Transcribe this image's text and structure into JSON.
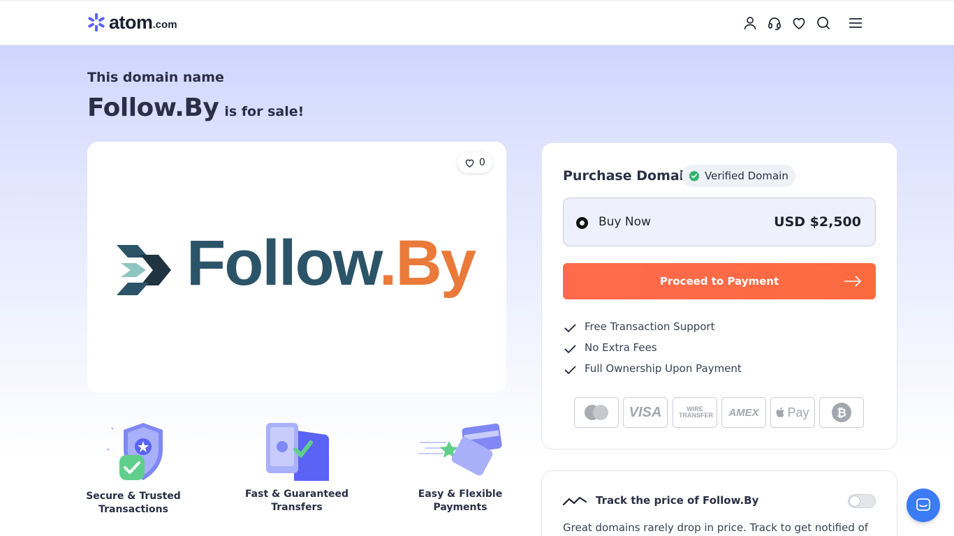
{
  "header": {
    "logo_word": "atom",
    "logo_tld": ".com",
    "icons": [
      "user-icon",
      "headset-icon",
      "heart-icon",
      "search-icon",
      "menu-icon"
    ]
  },
  "hero": {
    "eyebrow": "This domain name",
    "domain": "Follow.By",
    "suffix": "is for sale!"
  },
  "preview": {
    "like_count": "0",
    "brand_name": "Follow",
    "brand_tld": ".By"
  },
  "features": [
    {
      "label": "Secure & Trusted Transactions"
    },
    {
      "label": "Fast & Guaranteed Transfers"
    },
    {
      "label": "Easy & Flexible Payments"
    }
  ],
  "purchase": {
    "title": "Purchase Domain",
    "verified_label": "Verified Domain",
    "option_label": "Buy Now",
    "price": "USD $2,500",
    "cta": "Proceed to Payment",
    "perks": [
      "Free Transaction Support",
      "No Extra Fees",
      "Full Ownership Upon Payment"
    ],
    "payment_methods": [
      "VISA",
      "WIRE TRANSFER",
      "AMEX",
      "Pay"
    ]
  },
  "track": {
    "title": "Track the price of Follow.By",
    "description": "Great domains rarely drop in price. Track to get notified of"
  },
  "colors": {
    "accent": "#fb6b3f",
    "brand_blue": "#5b63f5",
    "verified_green": "#2fb36b",
    "chat_blue": "#3b7bf6"
  }
}
